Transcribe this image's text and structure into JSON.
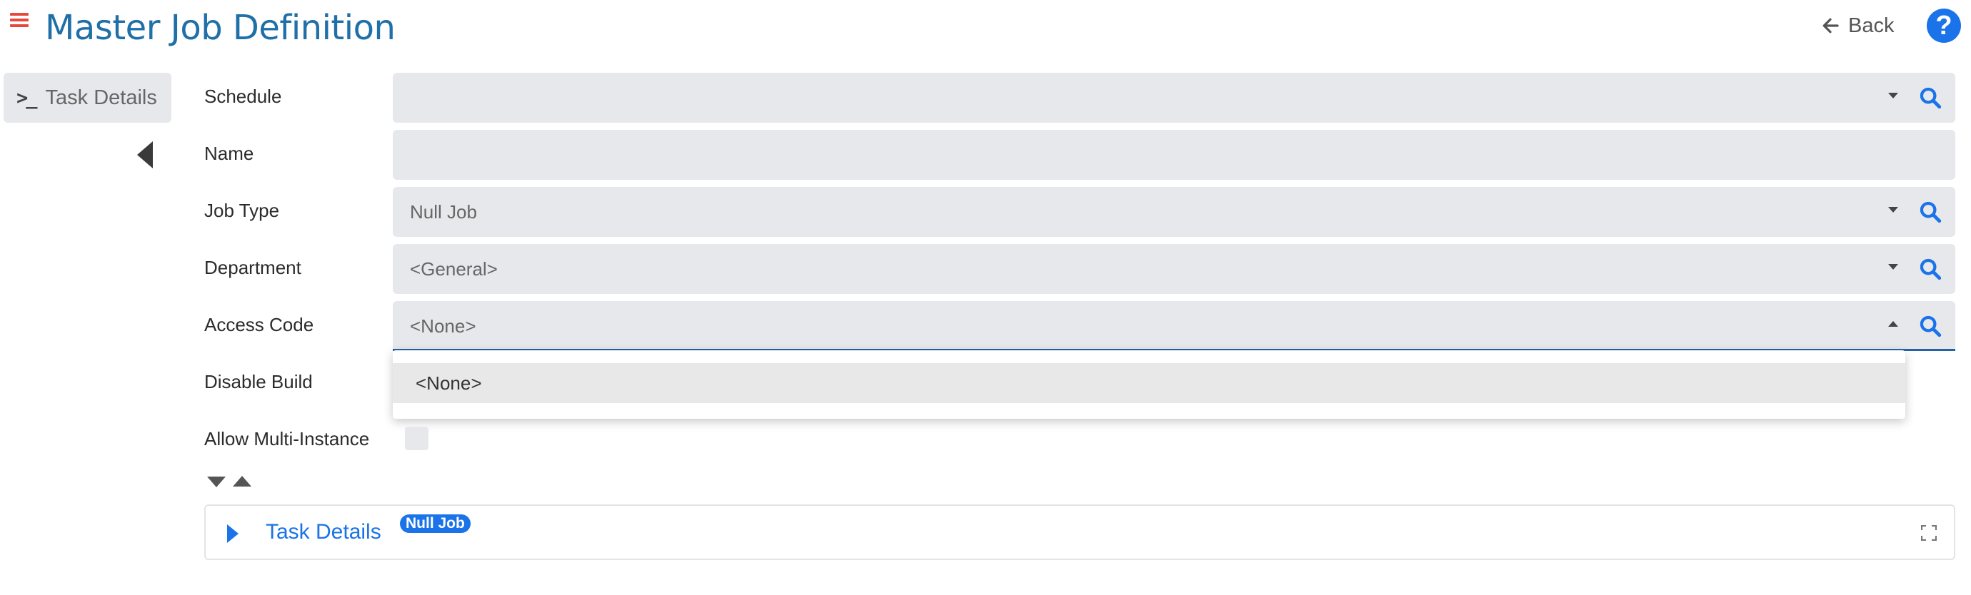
{
  "header": {
    "title": "Master Job Definition",
    "back_label": "Back",
    "help_label": "?"
  },
  "sidebar": {
    "tab_label": "Task Details"
  },
  "form": {
    "schedule": {
      "label": "Schedule",
      "value": ""
    },
    "name": {
      "label": "Name",
      "value": ""
    },
    "job_type": {
      "label": "Job Type",
      "value": "Null Job"
    },
    "department": {
      "label": "Department",
      "value": "<General>"
    },
    "access_code": {
      "label": "Access Code",
      "value": "<None>",
      "options": [
        "<None>"
      ]
    },
    "disable_build": {
      "label": "Disable Build"
    },
    "allow_multi_instance": {
      "label": "Allow Multi-Instance",
      "checked": false
    }
  },
  "task_panel": {
    "title": "Task Details",
    "badge": "Null Job"
  },
  "colors": {
    "accent": "#1a73e8",
    "title": "#1f6fa8",
    "hamburger": "#e8473b",
    "field_bg": "#e7e8ec"
  }
}
